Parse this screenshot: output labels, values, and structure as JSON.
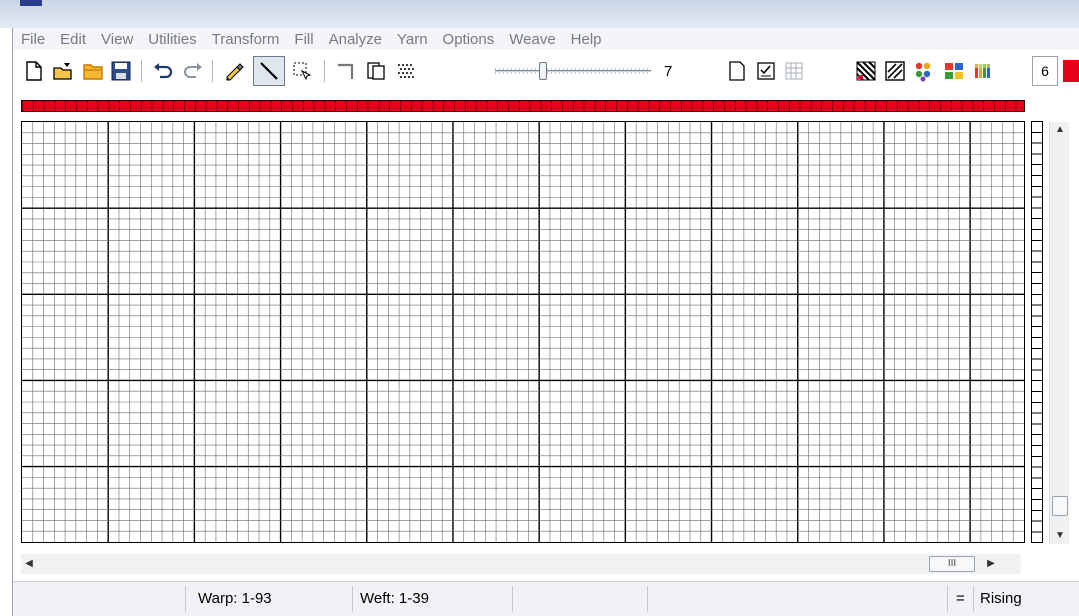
{
  "window": {
    "app_icon": "loom-app-icon"
  },
  "menu": [
    "File",
    "Edit",
    "View",
    "Utilities",
    "Transform",
    "Fill",
    "Analyze",
    "Yarn",
    "Options",
    "Weave",
    "Help"
  ],
  "toolbar": {
    "icons": [
      "new-document-icon",
      "open-icon",
      "open-folder-icon",
      "save-icon",
      "undo-icon",
      "redo-icon",
      "pencil-icon",
      "line-tool-icon",
      "select-tool-icon",
      "corner-icon",
      "copy-icon",
      "weave-pattern-icon",
      "blank-page-icon",
      "checklist-icon",
      "grid-icon",
      "pattern-a-icon",
      "pattern-b-icon",
      "palette-icon",
      "color-grid-icon",
      "color-stripes-icon"
    ],
    "slider_value": "7",
    "slider_level": 0.3,
    "number_value": "6",
    "current_color": "#e8001c"
  },
  "grid": {
    "columns": 93,
    "rows": 39,
    "major_every": 8
  },
  "status": {
    "warp": "Warp: 1-93",
    "weft": "Weft: 1-39",
    "equals": "=",
    "mode": "Rising"
  },
  "colors": {
    "warp_bar": "#e0001b",
    "grid_line": "#000000"
  }
}
